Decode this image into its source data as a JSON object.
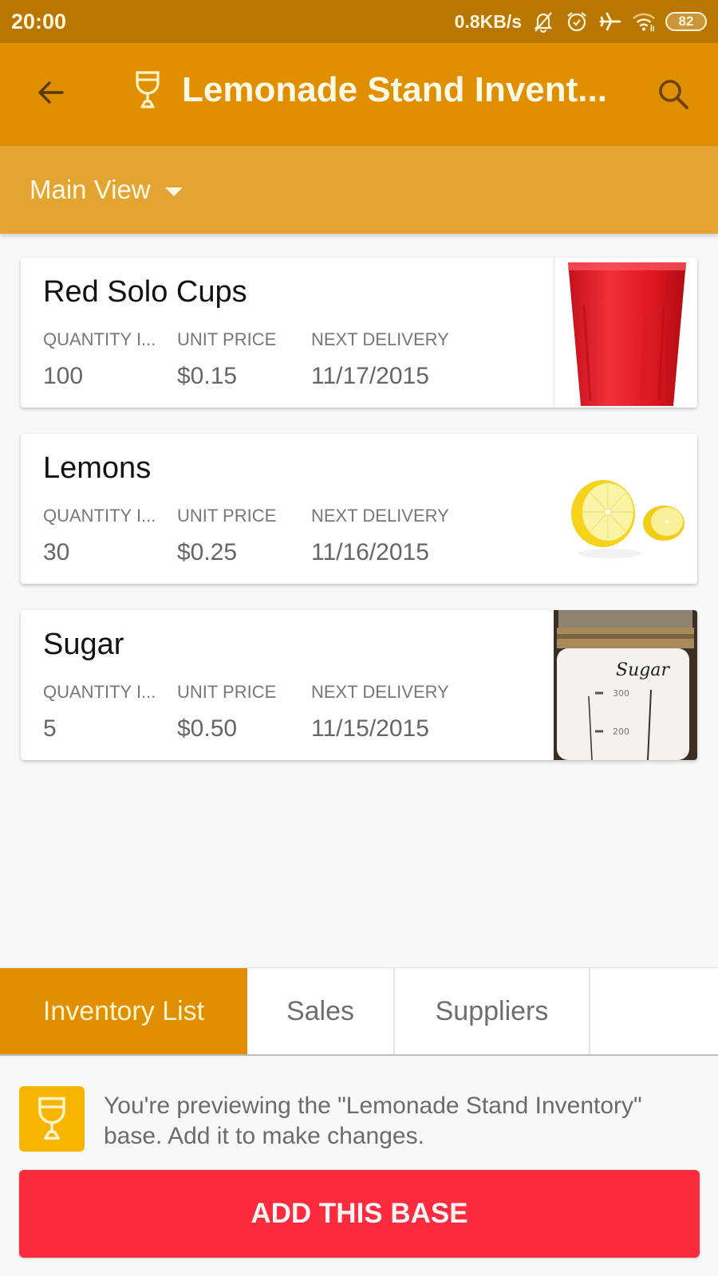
{
  "status_bar": {
    "time": "20:00",
    "network_speed": "0.8KB/s",
    "icons": [
      "bell-off-icon",
      "alarm-icon",
      "airplane-icon",
      "wifi-icon"
    ],
    "battery": "82"
  },
  "app_bar": {
    "back_icon": "arrow-left-icon",
    "base_icon": "wine-glass-icon",
    "title": "Lemonade Stand Invent...",
    "search_icon": "search-icon"
  },
  "view_bar": {
    "selected_view": "Main View"
  },
  "records": [
    {
      "name": "Red Solo Cups",
      "fields": [
        {
          "label": "QUANTITY I...",
          "value": "100"
        },
        {
          "label": "UNIT PRICE",
          "value": "$0.15"
        },
        {
          "label": "NEXT DELIVERY",
          "value": "11/17/2015"
        }
      ],
      "image": "red-cup-image"
    },
    {
      "name": "Lemons",
      "fields": [
        {
          "label": "QUANTITY I...",
          "value": "30"
        },
        {
          "label": "UNIT PRICE",
          "value": "$0.25"
        },
        {
          "label": "NEXT DELIVERY",
          "value": "11/16/2015"
        }
      ],
      "image": "lemon-image"
    },
    {
      "name": "Sugar",
      "fields": [
        {
          "label": "QUANTITY I...",
          "value": "5"
        },
        {
          "label": "UNIT PRICE",
          "value": "$0.50"
        },
        {
          "label": "NEXT DELIVERY",
          "value": "11/15/2015"
        }
      ],
      "image": "sugar-jar-image",
      "image_text": {
        "label": "Sugar",
        "mark_300": "300",
        "mark_200": "200"
      }
    }
  ],
  "tabs": [
    {
      "label": "Inventory List",
      "active": true
    },
    {
      "label": "Sales",
      "active": false
    },
    {
      "label": "Suppliers",
      "active": false
    },
    {
      "label": "",
      "active": false
    }
  ],
  "preview": {
    "message": "You're previewing the \"Lemonade Stand Inventory\" base. Add it to make changes.",
    "button_label": "ADD THIS BASE"
  },
  "colors": {
    "status_bar": "#b87700",
    "app_bar": "#e08f00",
    "view_bar": "#e3a432",
    "active_tab": "#e08f00",
    "base_icon_bg": "#f7b500",
    "add_button": "#fc2b3e"
  }
}
